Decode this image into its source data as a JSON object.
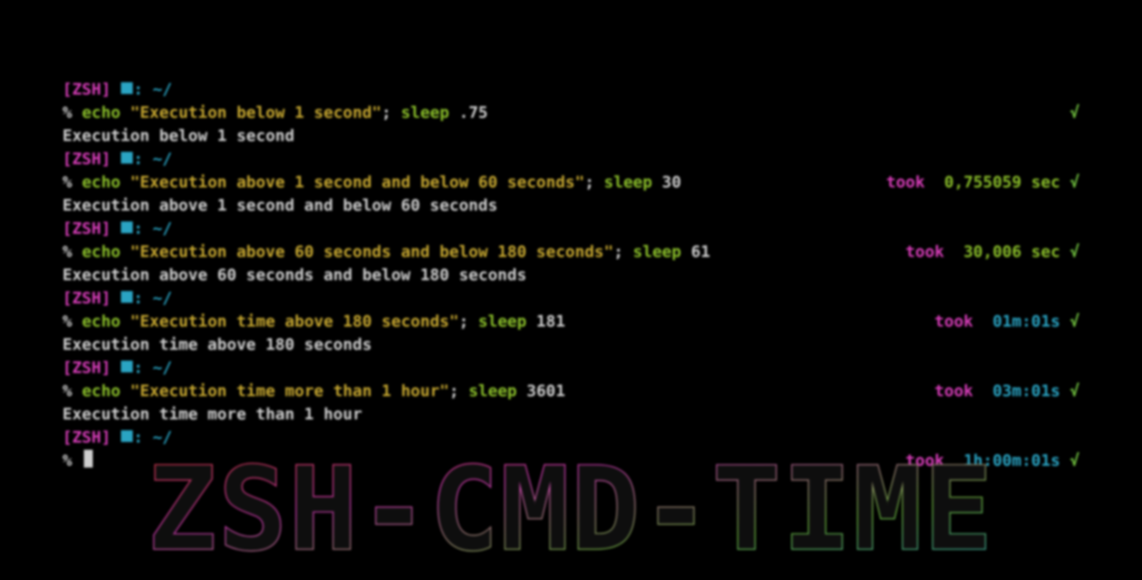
{
  "title_overlay": "ZSH-CMD-TIME",
  "prompt": {
    "shell_tag_open": "[",
    "shell_tag_name": "ZSH",
    "shell_tag_close": "]",
    "folder_glyph": "⯀:",
    "path": "~/",
    "symbol": "%"
  },
  "check_glyph": "√",
  "took_label": "took",
  "cursor": "_",
  "blocks": [
    {
      "cmd": {
        "echo": "echo",
        "arg": "\"Execution below 1 second\"",
        "semi": ";",
        "sleep": "sleep",
        "dur": ".75"
      },
      "right": {
        "took": false,
        "time": "",
        "time_class": "",
        "check": true
      },
      "output": "Execution below 1 second"
    },
    {
      "cmd": {
        "echo": "echo",
        "arg": "\"Execution above 1 second and below 60 seconds\"",
        "semi": ";",
        "sleep": "sleep",
        "dur": "30"
      },
      "right": {
        "took": true,
        "time": "0,755059 sec",
        "time_class": "time-g",
        "check": true
      },
      "output": "Execution above 1 second and below 60 seconds"
    },
    {
      "cmd": {
        "echo": "echo",
        "arg": "\"Execution above 60 seconds and below 180 seconds\"",
        "semi": ";",
        "sleep": "sleep",
        "dur": "61"
      },
      "right": {
        "took": true,
        "time": "30,006 sec",
        "time_class": "time-g",
        "check": true
      },
      "output": "Execution above 60 seconds and below 180 seconds"
    },
    {
      "cmd": {
        "echo": "echo",
        "arg": "\"Execution time above 180 seconds\"",
        "semi": ";",
        "sleep": "sleep",
        "dur": "181"
      },
      "right": {
        "took": true,
        "time": "01m:01s",
        "time_class": "time-c",
        "check": true
      },
      "output": "Execution time above 180 seconds"
    },
    {
      "cmd": {
        "echo": "echo",
        "arg": "\"Execution time more than 1 hour\"",
        "semi": ";",
        "sleep": "sleep",
        "dur": "3601"
      },
      "right": {
        "took": true,
        "time": "03m:01s",
        "time_class": "time-c",
        "check": true
      },
      "output": "Execution time more than 1 hour"
    }
  ],
  "final_right": {
    "took": true,
    "time": "1h:00m:01s",
    "time_class": "time-c",
    "check": true
  }
}
